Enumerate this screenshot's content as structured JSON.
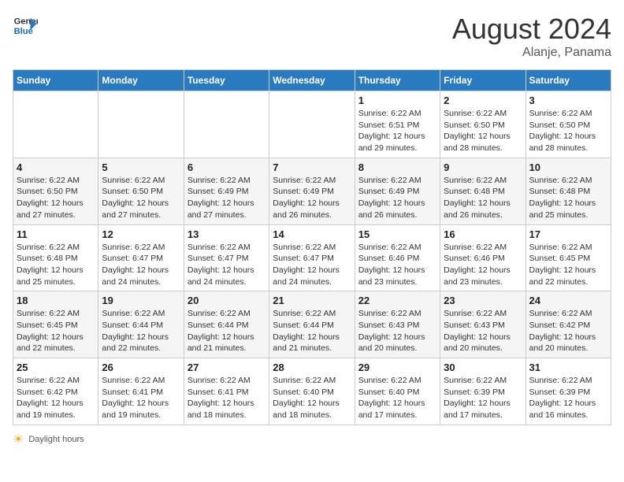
{
  "header": {
    "logo_line1": "General",
    "logo_line2": "Blue",
    "month": "August 2024",
    "location": "Alanje, Panama"
  },
  "weekdays": [
    "Sunday",
    "Monday",
    "Tuesday",
    "Wednesday",
    "Thursday",
    "Friday",
    "Saturday"
  ],
  "weeks": [
    [
      {
        "day": "",
        "info": ""
      },
      {
        "day": "",
        "info": ""
      },
      {
        "day": "",
        "info": ""
      },
      {
        "day": "",
        "info": ""
      },
      {
        "day": "1",
        "info": "Sunrise: 6:22 AM\nSunset: 6:51 PM\nDaylight: 12 hours\nand 29 minutes."
      },
      {
        "day": "2",
        "info": "Sunrise: 6:22 AM\nSunset: 6:50 PM\nDaylight: 12 hours\nand 28 minutes."
      },
      {
        "day": "3",
        "info": "Sunrise: 6:22 AM\nSunset: 6:50 PM\nDaylight: 12 hours\nand 28 minutes."
      }
    ],
    [
      {
        "day": "4",
        "info": "Sunrise: 6:22 AM\nSunset: 6:50 PM\nDaylight: 12 hours\nand 27 minutes."
      },
      {
        "day": "5",
        "info": "Sunrise: 6:22 AM\nSunset: 6:50 PM\nDaylight: 12 hours\nand 27 minutes."
      },
      {
        "day": "6",
        "info": "Sunrise: 6:22 AM\nSunset: 6:49 PM\nDaylight: 12 hours\nand 27 minutes."
      },
      {
        "day": "7",
        "info": "Sunrise: 6:22 AM\nSunset: 6:49 PM\nDaylight: 12 hours\nand 26 minutes."
      },
      {
        "day": "8",
        "info": "Sunrise: 6:22 AM\nSunset: 6:49 PM\nDaylight: 12 hours\nand 26 minutes."
      },
      {
        "day": "9",
        "info": "Sunrise: 6:22 AM\nSunset: 6:48 PM\nDaylight: 12 hours\nand 26 minutes."
      },
      {
        "day": "10",
        "info": "Sunrise: 6:22 AM\nSunset: 6:48 PM\nDaylight: 12 hours\nand 25 minutes."
      }
    ],
    [
      {
        "day": "11",
        "info": "Sunrise: 6:22 AM\nSunset: 6:48 PM\nDaylight: 12 hours\nand 25 minutes."
      },
      {
        "day": "12",
        "info": "Sunrise: 6:22 AM\nSunset: 6:47 PM\nDaylight: 12 hours\nand 24 minutes."
      },
      {
        "day": "13",
        "info": "Sunrise: 6:22 AM\nSunset: 6:47 PM\nDaylight: 12 hours\nand 24 minutes."
      },
      {
        "day": "14",
        "info": "Sunrise: 6:22 AM\nSunset: 6:47 PM\nDaylight: 12 hours\nand 24 minutes."
      },
      {
        "day": "15",
        "info": "Sunrise: 6:22 AM\nSunset: 6:46 PM\nDaylight: 12 hours\nand 23 minutes."
      },
      {
        "day": "16",
        "info": "Sunrise: 6:22 AM\nSunset: 6:46 PM\nDaylight: 12 hours\nand 23 minutes."
      },
      {
        "day": "17",
        "info": "Sunrise: 6:22 AM\nSunset: 6:45 PM\nDaylight: 12 hours\nand 22 minutes."
      }
    ],
    [
      {
        "day": "18",
        "info": "Sunrise: 6:22 AM\nSunset: 6:45 PM\nDaylight: 12 hours\nand 22 minutes."
      },
      {
        "day": "19",
        "info": "Sunrise: 6:22 AM\nSunset: 6:44 PM\nDaylight: 12 hours\nand 22 minutes."
      },
      {
        "day": "20",
        "info": "Sunrise: 6:22 AM\nSunset: 6:44 PM\nDaylight: 12 hours\nand 21 minutes."
      },
      {
        "day": "21",
        "info": "Sunrise: 6:22 AM\nSunset: 6:44 PM\nDaylight: 12 hours\nand 21 minutes."
      },
      {
        "day": "22",
        "info": "Sunrise: 6:22 AM\nSunset: 6:43 PM\nDaylight: 12 hours\nand 20 minutes."
      },
      {
        "day": "23",
        "info": "Sunrise: 6:22 AM\nSunset: 6:43 PM\nDaylight: 12 hours\nand 20 minutes."
      },
      {
        "day": "24",
        "info": "Sunrise: 6:22 AM\nSunset: 6:42 PM\nDaylight: 12 hours\nand 20 minutes."
      }
    ],
    [
      {
        "day": "25",
        "info": "Sunrise: 6:22 AM\nSunset: 6:42 PM\nDaylight: 12 hours\nand 19 minutes."
      },
      {
        "day": "26",
        "info": "Sunrise: 6:22 AM\nSunset: 6:41 PM\nDaylight: 12 hours\nand 19 minutes."
      },
      {
        "day": "27",
        "info": "Sunrise: 6:22 AM\nSunset: 6:41 PM\nDaylight: 12 hours\nand 18 minutes."
      },
      {
        "day": "28",
        "info": "Sunrise: 6:22 AM\nSunset: 6:40 PM\nDaylight: 12 hours\nand 18 minutes."
      },
      {
        "day": "29",
        "info": "Sunrise: 6:22 AM\nSunset: 6:40 PM\nDaylight: 12 hours\nand 17 minutes."
      },
      {
        "day": "30",
        "info": "Sunrise: 6:22 AM\nSunset: 6:39 PM\nDaylight: 12 hours\nand 17 minutes."
      },
      {
        "day": "31",
        "info": "Sunrise: 6:22 AM\nSunset: 6:39 PM\nDaylight: 12 hours\nand 16 minutes."
      }
    ]
  ],
  "footer": {
    "note": "Daylight hours"
  }
}
